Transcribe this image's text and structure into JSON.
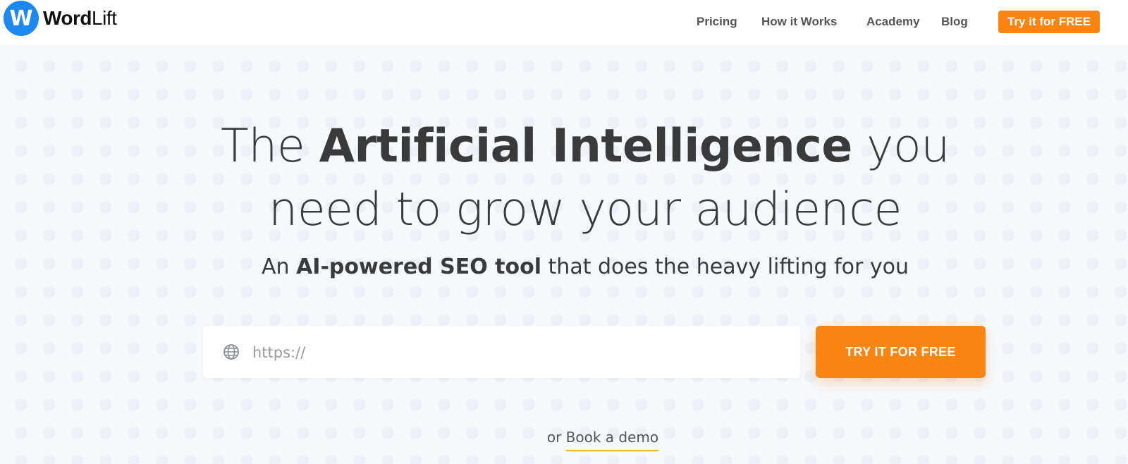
{
  "brand": {
    "logo_letter": "W",
    "name_bold": "Word",
    "name_rest": "Lift",
    "color": "#1f88f0"
  },
  "nav": {
    "items": [
      {
        "label": "Pricing"
      },
      {
        "label": "How it Works"
      },
      {
        "label": "Academy"
      },
      {
        "label": "Blog"
      }
    ],
    "cta_label": "Try it for FREE"
  },
  "hero": {
    "headline_part1": "The ",
    "headline_bold": "Artificial Intelligence",
    "headline_part2": " you",
    "headline_line2": "need to grow your audience",
    "subhead_part1": "An ",
    "subhead_bold": "AI-powered SEO tool",
    "subhead_part2": " that does the heavy lifting for you",
    "url_placeholder": "https://",
    "url_icon": "globe-icon",
    "cta_label": "TRY IT FOR FREE",
    "demo_prefix": "or ",
    "demo_link": "Book a demo"
  },
  "colors": {
    "accent": "#fb8512",
    "text": "#3a3a3a",
    "underline": "#f5b026"
  }
}
